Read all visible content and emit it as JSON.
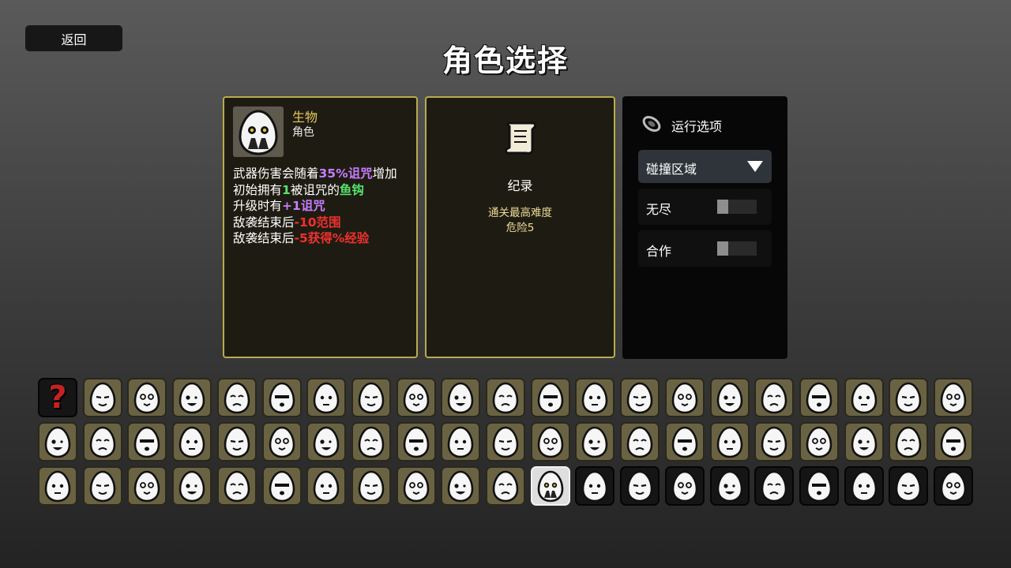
{
  "back_label": "返回",
  "title": "角色选择",
  "character": {
    "name": "生物",
    "type": "角色",
    "effects": [
      {
        "parts": [
          {
            "t": "武器伤害会随着",
            "c": ""
          },
          {
            "t": "35%诅咒",
            "c": "c-purple"
          },
          {
            "t": "增加",
            "c": ""
          }
        ]
      },
      {
        "parts": [
          {
            "t": "初始拥有",
            "c": ""
          },
          {
            "t": "1",
            "c": "c-green"
          },
          {
            "t": "被诅咒的",
            "c": ""
          },
          {
            "t": "鱼钩",
            "c": "c-green"
          }
        ]
      },
      {
        "parts": [
          {
            "t": "升级时有",
            "c": ""
          },
          {
            "t": "+1诅咒",
            "c": "c-purple"
          }
        ]
      },
      {
        "parts": [
          {
            "t": "敌袭结束后",
            "c": ""
          },
          {
            "t": "-10范围",
            "c": "c-red"
          }
        ]
      },
      {
        "parts": [
          {
            "t": "敌袭结束后",
            "c": ""
          },
          {
            "t": "-5获得%经验",
            "c": "c-red"
          }
        ]
      }
    ]
  },
  "record": {
    "title": "纪录",
    "line1": "通关最高难度",
    "line2": "危险5"
  },
  "run_options": {
    "title": "运行选项",
    "zone": "碰撞区域",
    "endless": "无尽",
    "coop": "合作"
  },
  "colors": {
    "gold_border": "#b9ab4d",
    "purple": "#c87cff",
    "green": "#57e36e",
    "red": "#f0312f",
    "name_gold": "#e8c95d"
  },
  "grid": {
    "rows": 3,
    "cols": 21,
    "random_icon": "?",
    "selected_tile": {
      "row": 2,
      "col": 11
    },
    "dark_tiles_from": {
      "row": 2,
      "col": 12
    }
  }
}
